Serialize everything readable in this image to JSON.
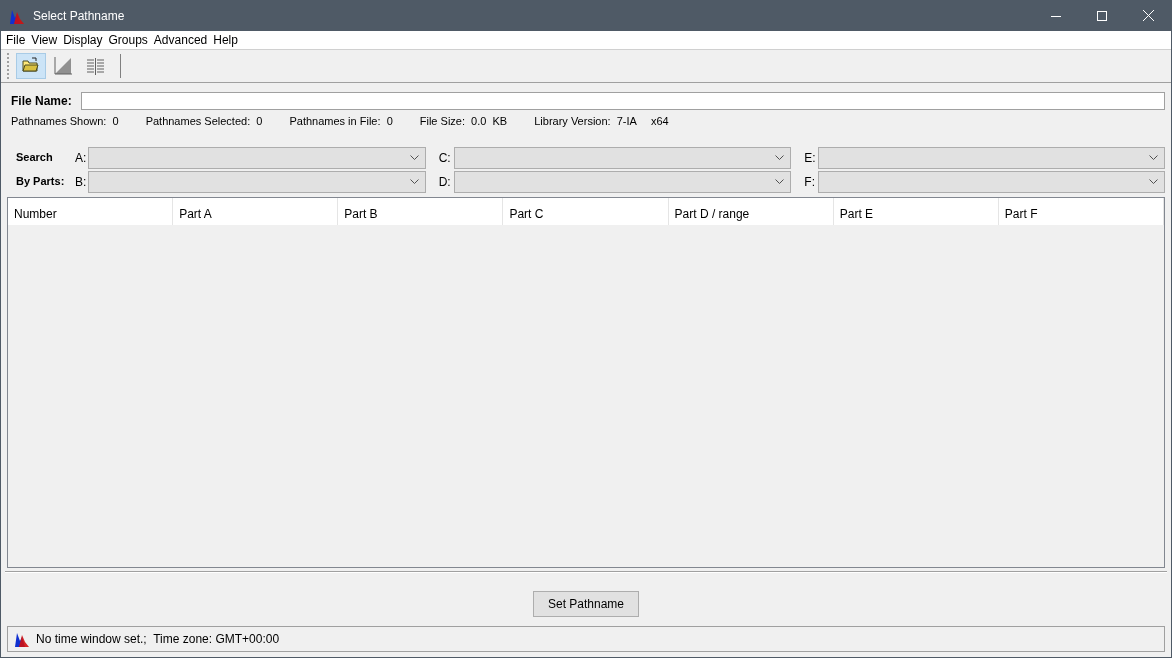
{
  "window": {
    "title": "Select Pathname"
  },
  "menu": [
    "File",
    "View",
    "Display",
    "Groups",
    "Advanced",
    "Help"
  ],
  "toolbar": [
    {
      "kind": "folder",
      "selected": true
    },
    {
      "kind": "ramp",
      "selected": false
    },
    {
      "kind": "columns",
      "selected": false
    }
  ],
  "file_name": {
    "label": "File Name:"
  },
  "stats": [
    {
      "label": "Pathnames Shown:",
      "value": "0"
    },
    {
      "label": "Pathnames Selected:",
      "value": "0"
    },
    {
      "label": "Pathnames in File:",
      "value": "0"
    },
    {
      "label": "File Size:",
      "value": "0.0  KB"
    },
    {
      "label": "Library Version:",
      "value": "7-IA",
      "extra": "x64"
    }
  ],
  "search": {
    "label_1": "Search",
    "label_2": "By Parts:",
    "parts": [
      "A:",
      "C:",
      "E:",
      "B:",
      "D:",
      "F:"
    ]
  },
  "table": {
    "columns": [
      "Number",
      "Part A",
      "Part B",
      "Part C",
      "Part D / range",
      "Part E",
      "Part F"
    ]
  },
  "set_button": "Set Pathname",
  "status_bar": "No time window set.;  Time zone: GMT+00:00"
}
